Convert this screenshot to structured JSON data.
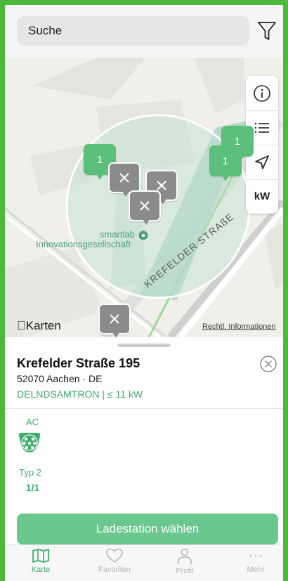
{
  "header": {
    "search_placeholder": "Suche",
    "filter_icon": "filter-funnel-icon"
  },
  "map": {
    "controls": [
      {
        "icon": "info-icon"
      },
      {
        "icon": "list-icon"
      },
      {
        "icon": "location-arrow-icon"
      },
      {
        "label": "kW"
      }
    ],
    "pins": [
      {
        "type": "cluster",
        "label": "1"
      },
      {
        "type": "cluster",
        "label": "1"
      },
      {
        "type": "cluster",
        "label": "1"
      },
      {
        "type": "unavailable"
      },
      {
        "type": "unavailable"
      },
      {
        "type": "unavailable"
      },
      {
        "type": "unavailable"
      }
    ],
    "poi_label_line1": "smartlab",
    "poi_label_line2": "Innovationsgesellschaft",
    "street_label": "KREFELDER STRAßE",
    "attribution": "Karten",
    "legal_link": "Rechtl. Informationen"
  },
  "station": {
    "title": "Krefelder Straße 195",
    "address": "52070 Aachen · DE",
    "operator": "DELNDSAMTRON | ≤ 11 kW",
    "connector": {
      "current_type": "AC",
      "plug_icon": "type2-plug-icon",
      "plug_name": "Typ 2",
      "availability": "1/1"
    },
    "action_label": "Ladestation wählen"
  },
  "tabs": [
    {
      "label": "Karte",
      "icon": "map-icon",
      "active": true
    },
    {
      "label": "Favoriten",
      "icon": "heart-icon",
      "active": false
    },
    {
      "label": "Profil",
      "icon": "person-icon",
      "active": false
    },
    {
      "label": "Mehr",
      "icon": "more-dots-icon",
      "active": false
    }
  ],
  "colors": {
    "accent": "#3fae6b",
    "cluster_pin": "#5cbf7c",
    "unavailable_pin": "#8b8b8b",
    "primary_button": "#6ac78e"
  }
}
